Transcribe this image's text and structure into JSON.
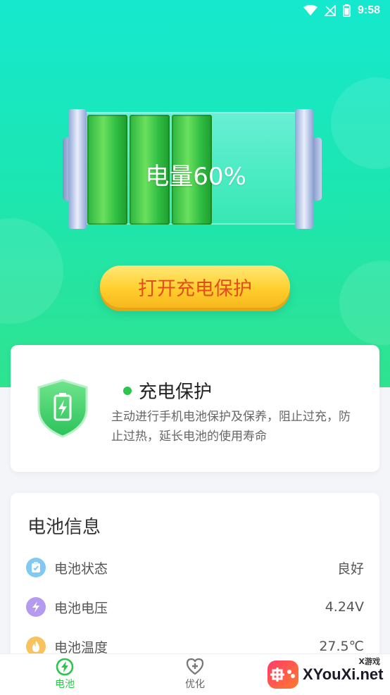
{
  "status_bar": {
    "time": "9:58"
  },
  "battery": {
    "level_label": "电量60%",
    "level_percent": 60,
    "cells_filled": 3
  },
  "action": {
    "button_label": "打开充电保护"
  },
  "protection_card": {
    "title": "充电保护",
    "description": "主动进行手机电池保护及保养，阻止过充，防止过热，延长电池的使用寿命"
  },
  "battery_info": {
    "title": "电池信息",
    "rows": [
      {
        "label": "电池状态",
        "value": "良好",
        "icon": "clipboard-icon",
        "color": "#7fc9f2"
      },
      {
        "label": "电池电压",
        "value": "4.24V",
        "icon": "lightning-icon",
        "color": "#b59bf0"
      },
      {
        "label": "电池温度",
        "value": "27.5℃",
        "icon": "flame-icon",
        "color": "#f7c35c"
      }
    ]
  },
  "tabbar": {
    "tabs": [
      {
        "label": "电池",
        "active": true,
        "icon": "battery-bolt-icon"
      },
      {
        "label": "优化",
        "active": false,
        "icon": "heart-plus-icon"
      }
    ]
  },
  "watermark": {
    "text": "XYouXi.net",
    "small": "X游戏"
  },
  "colors": {
    "primary": "#2cc64c",
    "accent_button": "#ffcf2e",
    "button_text": "#e34d1e"
  }
}
